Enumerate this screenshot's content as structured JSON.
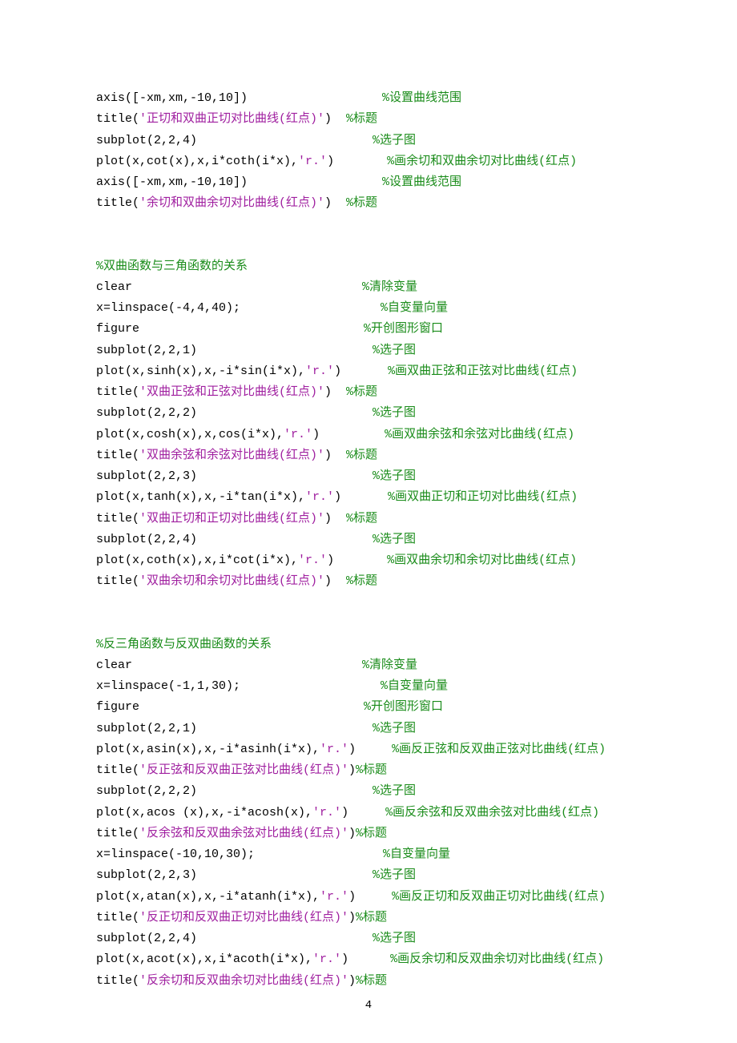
{
  "page_number": "4",
  "blocks": [
    {
      "lines": [
        {
          "code": "axis([-xm,xm,-10,10])",
          "pad": 168,
          "cmt": "%设置曲线范围"
        },
        {
          "code_parts": [
            {
              "t": "title(",
              "k": "code"
            },
            {
              "t": "'正切和双曲正切对比曲线(红点)'",
              "k": "str"
            },
            {
              "t": ")",
              "k": "code"
            }
          ],
          "pad": 18,
          "cmt": "%标题"
        },
        {
          "code": "subplot(2,2,4)",
          "pad": 219,
          "cmt": "%选子图"
        },
        {
          "code_parts": [
            {
              "t": "plot(x,cot(x),x,i*coth(i*x),",
              "k": "code"
            },
            {
              "t": "'r.'",
              "k": "str"
            },
            {
              "t": ")",
              "k": "code"
            }
          ],
          "pad": 66,
          "cmt": "%画余切和双曲余切对比曲线(红点)"
        },
        {
          "code": "axis([-xm,xm,-10,10])",
          "pad": 168,
          "cmt": "%设置曲线范围"
        },
        {
          "code_parts": [
            {
              "t": "title(",
              "k": "code"
            },
            {
              "t": "'余切和双曲余切对比曲线(红点)'",
              "k": "str"
            },
            {
              "t": ")",
              "k": "code"
            }
          ],
          "pad": 18,
          "cmt": "%标题"
        }
      ]
    },
    {
      "lines": [
        {
          "cmt_only": "%双曲函数与三角函数的关系"
        },
        {
          "code": "clear",
          "pad": 287,
          "cmt": "%清除变量"
        },
        {
          "code": "x=linspace(-4,4,40);",
          "pad": 175,
          "cmt": "%自变量向量"
        },
        {
          "code": "figure",
          "pad": 280,
          "cmt": "%开创图形窗口"
        },
        {
          "code": "subplot(2,2,1)",
          "pad": 219,
          "cmt": "%选子图"
        },
        {
          "code_parts": [
            {
              "t": "plot(x,sinh(x),x,-i*sin(i*x),",
              "k": "code"
            },
            {
              "t": "'r.'",
              "k": "str"
            },
            {
              "t": ")",
              "k": "code"
            }
          ],
          "pad": 58,
          "cmt": "%画双曲正弦和正弦对比曲线(红点)"
        },
        {
          "code_parts": [
            {
              "t": "title(",
              "k": "code"
            },
            {
              "t": "'双曲正弦和正弦对比曲线(红点)'",
              "k": "str"
            },
            {
              "t": ")",
              "k": "code"
            }
          ],
          "pad": 18,
          "cmt": "%标题"
        },
        {
          "code": "subplot(2,2,2)",
          "pad": 219,
          "cmt": "%选子图"
        },
        {
          "code_parts": [
            {
              "t": "plot(x,cosh(x),x,cos(i*x),",
              "k": "code"
            },
            {
              "t": "'r.'",
              "k": "str"
            },
            {
              "t": ")",
              "k": "code"
            }
          ],
          "pad": 81,
          "cmt": "%画双曲余弦和余弦对比曲线(红点)"
        },
        {
          "code_parts": [
            {
              "t": "title(",
              "k": "code"
            },
            {
              "t": "'双曲余弦和余弦对比曲线(红点)'",
              "k": "str"
            },
            {
              "t": ")",
              "k": "code"
            }
          ],
          "pad": 18,
          "cmt": "%标题"
        },
        {
          "code": "subplot(2,2,3)",
          "pad": 219,
          "cmt": "%选子图"
        },
        {
          "code_parts": [
            {
              "t": "plot(x,tanh(x),x,-i*tan(i*x),",
              "k": "code"
            },
            {
              "t": "'r.'",
              "k": "str"
            },
            {
              "t": ")",
              "k": "code"
            }
          ],
          "pad": 58,
          "cmt": "%画双曲正切和正切对比曲线(红点)"
        },
        {
          "code_parts": [
            {
              "t": "title(",
              "k": "code"
            },
            {
              "t": "'双曲正切和正切对比曲线(红点)'",
              "k": "str"
            },
            {
              "t": ")",
              "k": "code"
            }
          ],
          "pad": 18,
          "cmt": "%标题"
        },
        {
          "code": "subplot(2,2,4)",
          "pad": 219,
          "cmt": "%选子图"
        },
        {
          "code_parts": [
            {
              "t": "plot(x,coth(x),x,i*cot(i*x),",
              "k": "code"
            },
            {
              "t": "'r.'",
              "k": "str"
            },
            {
              "t": ")",
              "k": "code"
            }
          ],
          "pad": 66,
          "cmt": "%画双曲余切和余切对比曲线(红点)"
        },
        {
          "code_parts": [
            {
              "t": "title(",
              "k": "code"
            },
            {
              "t": "'双曲余切和余切对比曲线(红点)'",
              "k": "str"
            },
            {
              "t": ")",
              "k": "code"
            }
          ],
          "pad": 18,
          "cmt": "%标题"
        }
      ]
    },
    {
      "lines": [
        {
          "cmt_only": "%反三角函数与反双曲函数的关系"
        },
        {
          "code": "clear",
          "pad": 287,
          "cmt": "%清除变量"
        },
        {
          "code": "x=linspace(-1,1,30);",
          "pad": 175,
          "cmt": "%自变量向量"
        },
        {
          "code": "figure",
          "pad": 280,
          "cmt": "%开创图形窗口"
        },
        {
          "code": "subplot(2,2,1)",
          "pad": 219,
          "cmt": "%选子图"
        },
        {
          "code_parts": [
            {
              "t": "plot(x,asin(x),x,-i*asinh(i*x),",
              "k": "code"
            },
            {
              "t": "'r.'",
              "k": "str"
            },
            {
              "t": ")",
              "k": "code"
            }
          ],
          "pad": 45,
          "cmt": "%画反正弦和反双曲正弦对比曲线(红点)"
        },
        {
          "code_parts": [
            {
              "t": "title(",
              "k": "code"
            },
            {
              "t": "'反正弦和反双曲正弦对比曲线(红点)'",
              "k": "str"
            },
            {
              "t": ")",
              "k": "code"
            }
          ],
          "pad": 0,
          "cmt": "%标题"
        },
        {
          "code": "subplot(2,2,2)",
          "pad": 219,
          "cmt": "%选子图"
        },
        {
          "code_parts": [
            {
              "t": "plot(x,acos (x),x,-i*acosh(x),",
              "k": "code"
            },
            {
              "t": "'r.'",
              "k": "str"
            },
            {
              "t": ")",
              "k": "code"
            }
          ],
          "pad": 46,
          "cmt": "%画反余弦和反双曲余弦对比曲线(红点)"
        },
        {
          "code_parts": [
            {
              "t": "title(",
              "k": "code"
            },
            {
              "t": "'反余弦和反双曲余弦对比曲线(红点)'",
              "k": "str"
            },
            {
              "t": ")",
              "k": "code"
            }
          ],
          "pad": 0,
          "cmt": "%标题"
        },
        {
          "code": "x=linspace(-10,10,30);",
          "pad": 160,
          "cmt": "%自变量向量"
        },
        {
          "code": "subplot(2,2,3)",
          "pad": 219,
          "cmt": "%选子图"
        },
        {
          "code_parts": [
            {
              "t": "plot(x,atan(x),x,-i*atanh(i*x),",
              "k": "code"
            },
            {
              "t": "'r.'",
              "k": "str"
            },
            {
              "t": ")",
              "k": "code"
            }
          ],
          "pad": 45,
          "cmt": "%画反正切和反双曲正切对比曲线(红点)"
        },
        {
          "code_parts": [
            {
              "t": "title(",
              "k": "code"
            },
            {
              "t": "'反正切和反双曲正切对比曲线(红点)'",
              "k": "str"
            },
            {
              "t": ")",
              "k": "code"
            }
          ],
          "pad": 0,
          "cmt": "%标题"
        },
        {
          "code": "subplot(2,2,4)",
          "pad": 219,
          "cmt": "%选子图"
        },
        {
          "code_parts": [
            {
              "t": "plot(x,acot(x),x,i*acoth(i*x),",
              "k": "code"
            },
            {
              "t": "'r.'",
              "k": "str"
            },
            {
              "t": ")",
              "k": "code"
            }
          ],
          "pad": 52,
          "cmt": "%画反余切和反双曲余切对比曲线(红点)"
        },
        {
          "code_parts": [
            {
              "t": "title(",
              "k": "code"
            },
            {
              "t": "'反余切和反双曲余切对比曲线(红点)'",
              "k": "str"
            },
            {
              "t": ")",
              "k": "code"
            }
          ],
          "pad": 0,
          "cmt": "%标题"
        }
      ]
    }
  ]
}
